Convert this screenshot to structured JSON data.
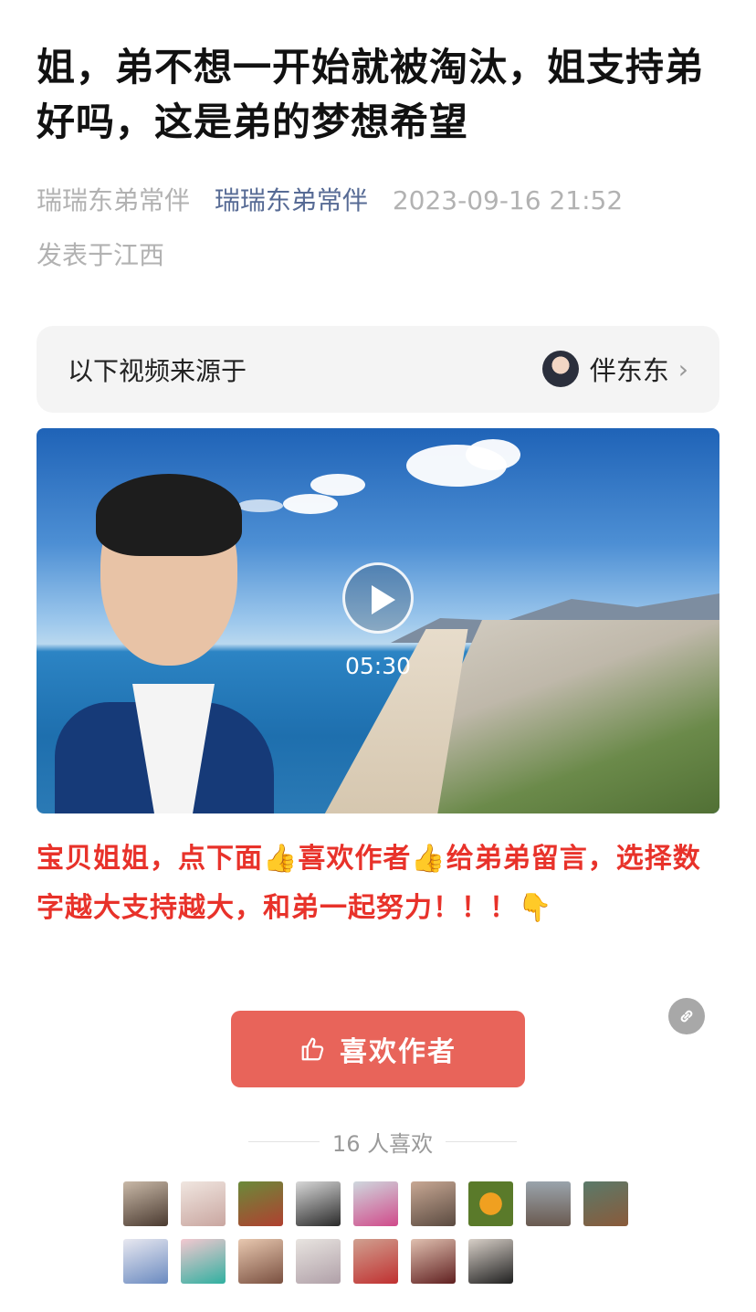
{
  "article": {
    "title": "姐，弟不想一开始就被淘汰，姐支持弟好吗，这是弟的梦想希望",
    "author": "瑞瑞东弟常伴",
    "account": "瑞瑞东弟常伴",
    "datetime": "2023-09-16 21:52",
    "location": "发表于江西"
  },
  "source": {
    "label": "以下视频来源于",
    "channel_name": "伴东东",
    "chevron": "›"
  },
  "video": {
    "duration": "05:30",
    "play_icon": "play-icon"
  },
  "body_text": "宝贝姐姐，点下面👍喜欢作者👍给弟弟留言，选择数字越大支持越大，和弟一起努力！！！👇",
  "like_button": {
    "label": "喜欢作者",
    "icon": "thumbs-up-icon",
    "color": "#e8645a"
  },
  "likes": {
    "count_text": "16 人喜欢"
  },
  "colors": {
    "title": "#111111",
    "meta": "#b2b2b2",
    "account_link": "#576b95",
    "body_red": "#e8322a"
  },
  "link_icon": "link-icon"
}
